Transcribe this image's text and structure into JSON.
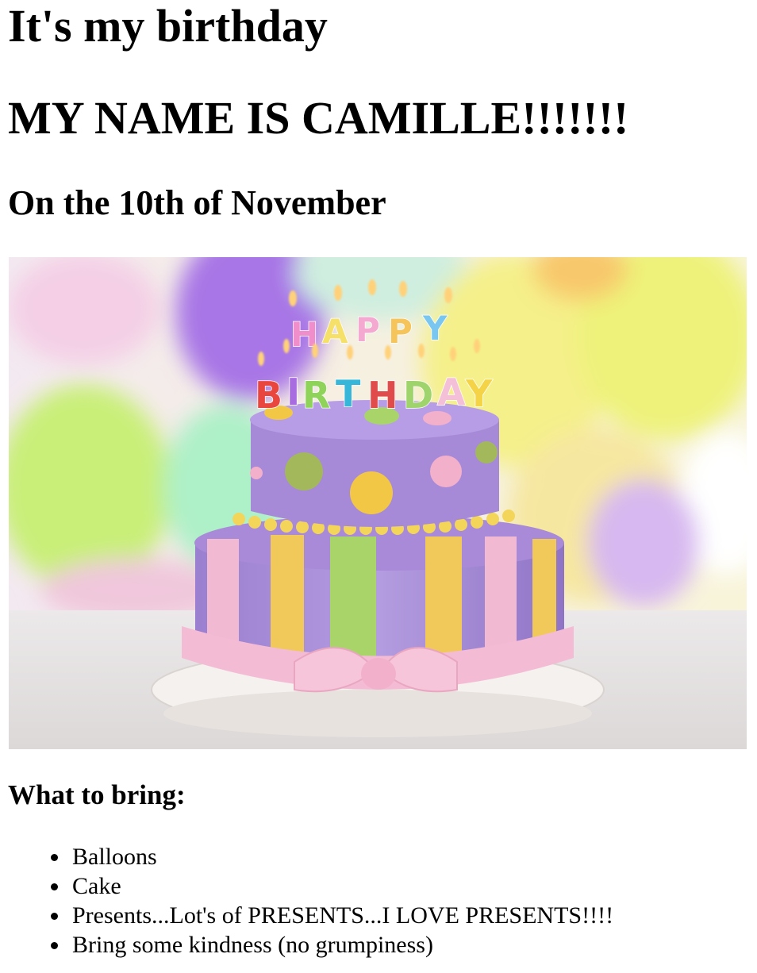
{
  "page": {
    "title": "It's my birthday",
    "name_line": "MY NAME IS CAMILLE!!!!!!!",
    "date_line": "On the 10th of November",
    "photo": {
      "description_icon": "birthday-cake-image",
      "candle_text_top": "HAPPY",
      "candle_text_bottom": "BIRTHDAY"
    },
    "bring_heading": "What to bring:",
    "bring_items": [
      "Balloons",
      "Cake",
      "Presents...Lot's of PRESENTS...I LOVE PRESENTS!!!!",
      "Bring some kindness (no grumpiness)"
    ]
  }
}
